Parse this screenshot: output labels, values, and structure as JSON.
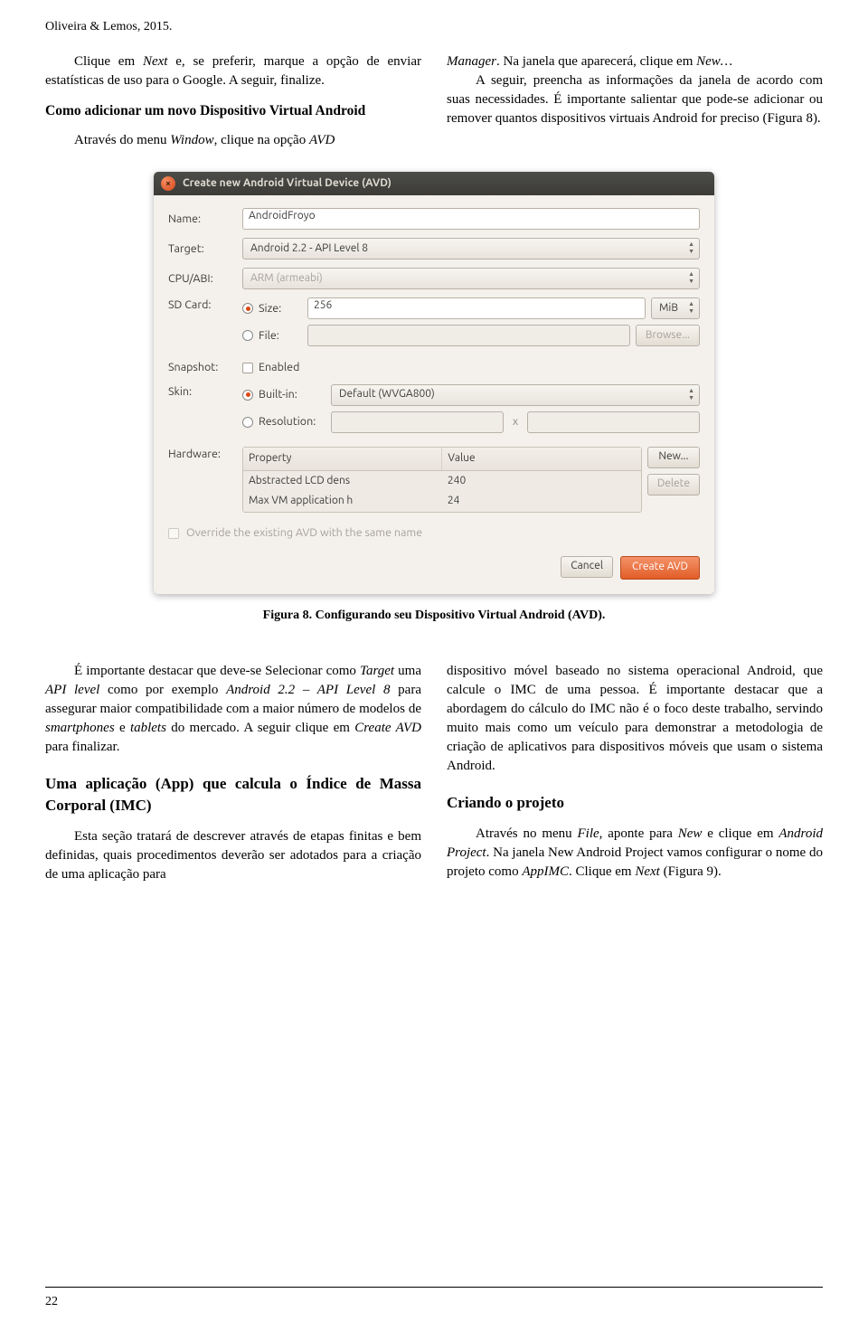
{
  "author_line": "Oliveira & Lemos, 2015.",
  "top_left": {
    "p1_a": "Clique em ",
    "p1_b": "Next",
    "p1_c": " e, se preferir, marque a opção de enviar estatísticas de uso para o Google. A seguir, finalize.",
    "subhead": "Como adicionar um novo Dispositivo Virtual Android",
    "p2_a": "Através do menu ",
    "p2_b": "Window",
    "p2_c": ", clique na opção ",
    "p2_d": "AVD"
  },
  "top_right": {
    "p1_a": "Manager",
    "p1_b": ". Na janela que aparecerá, clique em ",
    "p1_c": "New…",
    "p2": "A seguir, preencha as informações da janela de acordo com suas necessidades. É importante salientar que pode-se adicionar ou remover quantos dispositivos virtuais Android for preciso (Figura 8)."
  },
  "dialog": {
    "title": "Create new Android Virtual Device (AVD)",
    "labels": {
      "name": "Name:",
      "target": "Target:",
      "cpu": "CPU/ABI:",
      "sdcard": "SD Card:",
      "size": "Size:",
      "file": "File:",
      "snapshot": "Snapshot:",
      "enabled": "Enabled",
      "skin": "Skin:",
      "builtin": "Built-in:",
      "resolution": "Resolution:",
      "x": "x",
      "hardware": "Hardware:",
      "override": "Override the existing AVD with the same name"
    },
    "values": {
      "name": "AndroidFroyo",
      "target": "Android 2.2 - API Level 8",
      "cpu": "ARM (armeabi)",
      "sd_size": "256",
      "sd_unit": "MiB",
      "browse": "Browse...",
      "skin_default": "Default (WVGA800)"
    },
    "hw": {
      "col1": "Property",
      "col2": "Value",
      "rows": [
        {
          "prop": "Abstracted LCD dens",
          "val": "240"
        },
        {
          "prop": "Max VM application h",
          "val": "24"
        }
      ],
      "new": "New...",
      "delete": "Delete"
    },
    "buttons": {
      "cancel": "Cancel",
      "create": "Create AVD"
    }
  },
  "figure_caption": "Figura 8. Configurando seu Dispositivo Virtual Android (AVD).",
  "bottom_left": {
    "p1_a": "É importante destacar que deve-se Selecionar como ",
    "p1_b": "Target",
    "p1_c": " uma ",
    "p1_d": "API level",
    "p1_e": " como por exemplo ",
    "p1_f": "Android 2.2 – API Level 8",
    "p1_g": " para assegurar maior compatibilidade com a maior número de modelos de ",
    "p1_h": "smartphones",
    "p1_i": " e ",
    "p1_j": "tablets",
    "p1_k": " do mercado.  A seguir clique em ",
    "p1_l": "Create AVD",
    "p1_m": " para finalizar.",
    "sec_head": "Uma aplicação (App) que calcula o Índice de Massa Corporal (IMC)",
    "p2": "Esta seção tratará de descrever através de etapas finitas e bem definidas, quais procedimentos deverão ser adotados para a criação de uma aplicação para"
  },
  "bottom_right": {
    "p1": "dispositivo móvel baseado no sistema operacional Android, que calcule o IMC de uma pessoa. É importante destacar que a abordagem do cálculo do IMC não é o foco deste trabalho, servindo muito mais como um veículo para demonstrar a metodologia de criação de aplicativos para dispositivos móveis que usam o sistema Android.",
    "sec_head": "Criando o projeto",
    "p2_a": "Através no menu ",
    "p2_b": "File",
    "p2_c": ", aponte para ",
    "p2_d": "New",
    "p2_e": " e clique em ",
    "p2_f": "Android Project",
    "p2_g": ". Na janela New Android Project vamos configurar o nome do projeto como ",
    "p2_h": "AppIMC",
    "p2_i": ". Clique em ",
    "p2_j": "Next",
    "p2_k": " (Figura 9)."
  },
  "page_number": "22"
}
